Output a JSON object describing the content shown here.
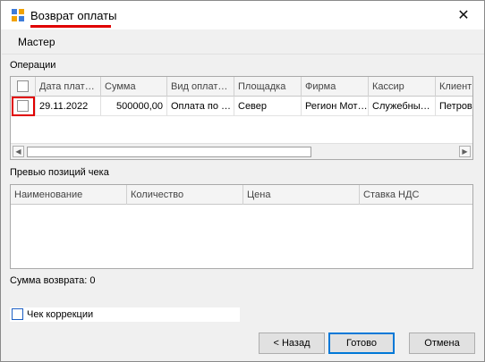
{
  "window": {
    "title": "Возврат оплаты",
    "close_glyph": "✕"
  },
  "subheader": {
    "label": "Мастер"
  },
  "operations": {
    "label": "Операции",
    "columns": [
      "Дата плат…",
      "Сумма",
      "Вид оплат…",
      "Площадка",
      "Фирма",
      "Кассир",
      "Клиент"
    ],
    "rows": [
      {
        "date": "29.11.2022",
        "amount": "500000,00",
        "payment_type": "Оплата по …",
        "site": "Север",
        "firm": "Регион Мот…",
        "cashier": "Служебны…",
        "client": "Петров"
      }
    ]
  },
  "preview": {
    "label": "Превью позиций чека",
    "columns": [
      "Наименование",
      "Количество",
      "Цена",
      "Ставка НДС"
    ]
  },
  "refund_sum": {
    "text": "Сумма возврата: 0"
  },
  "correction": {
    "label": "Чек коррекции"
  },
  "buttons": {
    "back": "< Назад",
    "done": "Готово",
    "cancel": "Отмена"
  },
  "colors": {
    "accent_red": "#e00000",
    "focus_blue": "#0078d7"
  }
}
